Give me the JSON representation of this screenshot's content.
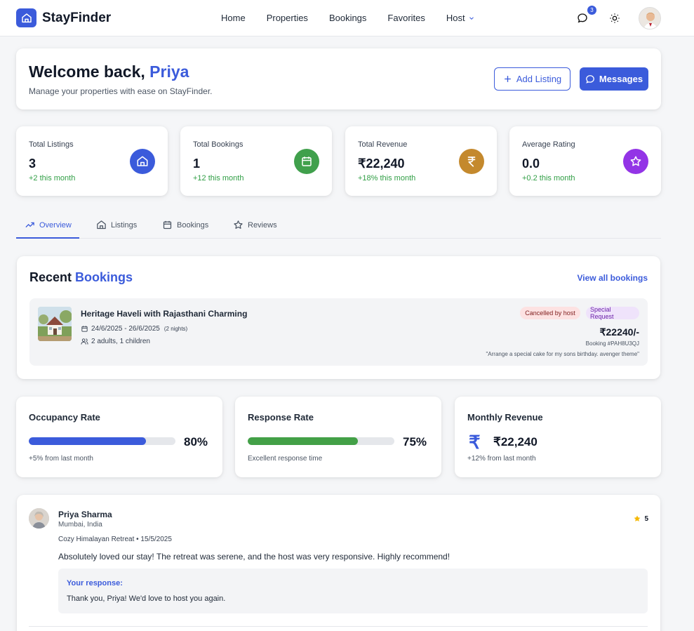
{
  "nav": {
    "brand": "StayFinder",
    "links": [
      "Home",
      "Properties",
      "Bookings",
      "Favorites"
    ],
    "host_label": "Host",
    "message_count": "3"
  },
  "welcome": {
    "greeting": "Welcome back, ",
    "name": "Priya",
    "subtitle": "Manage your properties with ease on StayFinder.",
    "add_listing": "Add Listing",
    "messages": "Messages"
  },
  "stats": [
    {
      "label": "Total Listings",
      "value": "3",
      "change": "+2 this month",
      "color": "#3b5bdb"
    },
    {
      "label": "Total Bookings",
      "value": "1",
      "change": "+12 this month",
      "color": "#40a04c"
    },
    {
      "label": "Total Revenue",
      "value": "₹22,240",
      "change": "+18% this month",
      "color": "#c4892d"
    },
    {
      "label": "Average Rating",
      "value": "0.0",
      "change": "+0.2 this month",
      "color": "#9334e6"
    }
  ],
  "tabs": [
    "Overview",
    "Listings",
    "Bookings",
    "Reviews"
  ],
  "recent": {
    "title_a": "Recent ",
    "title_b": "Bookings",
    "view_all": "View all bookings",
    "booking": {
      "title": "Heritage Haveli with Rajasthani Charming",
      "dates": "24/6/2025 - 26/6/2025",
      "nights": "(2 nights)",
      "guests": "2 adults, 1 children",
      "status": "Cancelled by host",
      "tag": "Special Request",
      "price": "₹22240/-",
      "booking_id": "Booking #PAH8U3QJ",
      "note": "\"Arrange a special cake for my sons birthday. avenger theme\""
    }
  },
  "metrics": {
    "occupancy": {
      "title": "Occupancy Rate",
      "percent": 80,
      "label": "80%",
      "sub": "+5% from last month",
      "color": "#3b5bdb"
    },
    "response": {
      "title": "Response Rate",
      "percent": 75,
      "label": "75%",
      "sub": "Excellent response time",
      "color": "#43a047"
    },
    "revenue": {
      "title": "Monthly Revenue",
      "symbol": "₹",
      "value": "₹22,240",
      "sub": "+12% from last month"
    }
  },
  "review": {
    "name": "Priya Sharma",
    "location": "Mumbai, India",
    "rating": "5",
    "property": "Cozy Himalayan Retreat • 15/5/2025",
    "text": "Absolutely loved our stay! The retreat was serene, and the host was very responsive. Highly recommend!",
    "response_label": "Your response:",
    "response_text": "Thank you, Priya! We'd love to host you again."
  }
}
